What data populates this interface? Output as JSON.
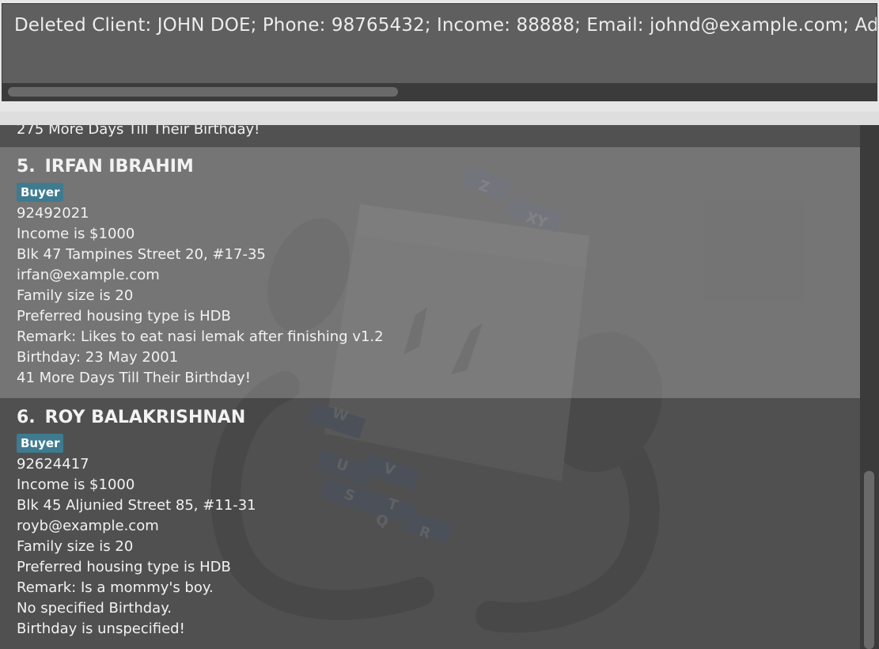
{
  "result_display": {
    "text": "Deleted Client: JOHN DOE; Phone: 98765432; Income: 88888; Email: johnd@example.com; Address:"
  },
  "clients": [
    {
      "partial_line": "275 More Days Till Their Birthday!"
    },
    {
      "index": "5.",
      "name": "IRFAN IBRAHIM",
      "tag": "Buyer",
      "phone": "92492021",
      "income": "Income is $1000",
      "address": "Blk 47 Tampines Street 20, #17-35",
      "email": "irfan@example.com",
      "family": "Family size is 20",
      "housing": "Preferred housing type is HDB",
      "remark": "Remark: Likes to eat nasi lemak after finishing v1.2",
      "birthday": "Birthday: 23 May 2001",
      "countdown": "41 More Days Till Their Birthday!"
    },
    {
      "index": "6.",
      "name": "ROY BALAKRISHNAN",
      "tag": "Buyer",
      "phone": "92624417",
      "income": "Income is $1000",
      "address": "Blk 45 Aljunied Street 85, #11-31",
      "email": "royb@example.com",
      "family": "Family size is 20",
      "housing": "Preferred housing type is HDB",
      "remark": "Remark: Is a mommy's boy.",
      "birthday": "No specified Birthday.",
      "countdown": "Birthday is unspecified!"
    }
  ],
  "watermark": {
    "letters": [
      "Z",
      "XY",
      "W",
      "V",
      "U",
      "T",
      "S",
      "Q",
      "R"
    ]
  },
  "colors": {
    "tag_bg": "#3e7b91",
    "selected_card": "#7d7d7d",
    "panel_bg": "#5f5f5f"
  }
}
